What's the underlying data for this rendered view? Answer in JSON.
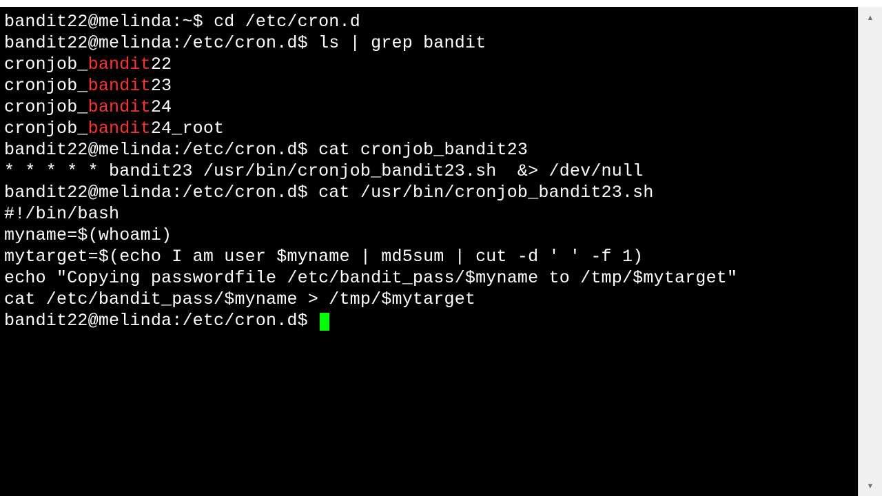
{
  "prompt_home": "bandit22@melinda:~$ ",
  "prompt_cron": "bandit22@melinda:/etc/cron.d$ ",
  "cmd_cd": "cd /etc/cron.d",
  "cmd_ls": "ls | grep bandit",
  "grep_results": [
    {
      "pre": "cronjob_",
      "match": "bandit",
      "post": "22"
    },
    {
      "pre": "cronjob_",
      "match": "bandit",
      "post": "23"
    },
    {
      "pre": "cronjob_",
      "match": "bandit",
      "post": "24"
    },
    {
      "pre": "cronjob_",
      "match": "bandit",
      "post": "24_root"
    }
  ],
  "cmd_cat1": "cat cronjob_bandit23",
  "cat1_out": "* * * * * bandit23 /usr/bin/cronjob_bandit23.sh  &> /dev/null",
  "cmd_cat2": "cat /usr/bin/cronjob_bandit23.sh",
  "script_lines": [
    "#!/bin/bash",
    "",
    "myname=$(whoami)",
    "mytarget=$(echo I am user $myname | md5sum | cut -d ' ' -f 1)",
    "",
    "echo \"Copying passwordfile /etc/bandit_pass/$myname to /tmp/$mytarget\"",
    "",
    "cat /etc/bandit_pass/$myname > /tmp/$mytarget"
  ],
  "scroll": {
    "up_glyph": "▴",
    "down_glyph": "▾"
  }
}
